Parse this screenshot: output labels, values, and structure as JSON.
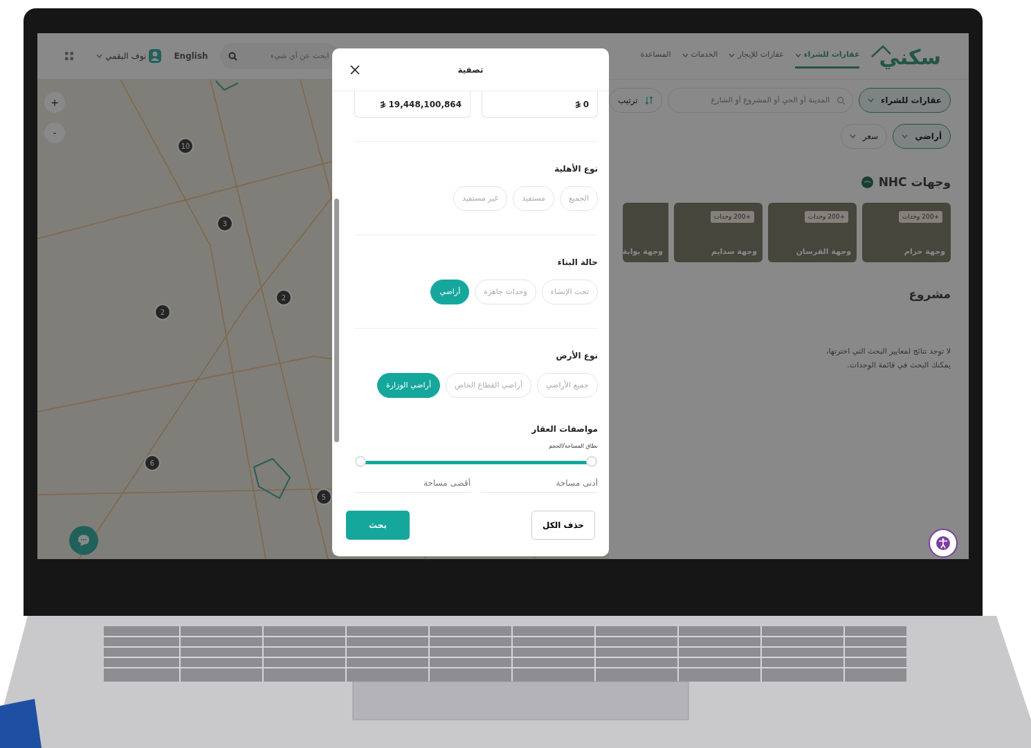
{
  "header": {
    "logo": "سكني",
    "nav": [
      {
        "label": "عقارات للشراء",
        "selected": true,
        "dropdown": true
      },
      {
        "label": "عقارات للإيجار",
        "selected": false,
        "dropdown": true
      },
      {
        "label": "الخدمات",
        "selected": false,
        "dropdown": true
      },
      {
        "label": "المساعدة",
        "selected": false,
        "dropdown": false
      }
    ],
    "search_placeholder": "ابحث عن أي شيء",
    "language": "English",
    "user": "نوف البقمي"
  },
  "map": {
    "zoom_in": "+",
    "zoom_out": "-",
    "markers": [
      {
        "label": "10"
      },
      {
        "label": "3"
      },
      {
        "label": "2"
      },
      {
        "label": "2"
      },
      {
        "label": "6"
      },
      {
        "label": "5"
      }
    ]
  },
  "results": {
    "search_placeholder": "المدينة أو الحي أو المشروع أو الشارع",
    "sort": "ترتيب",
    "filters": [
      {
        "label": "عقارات للشراء",
        "selected": true
      },
      {
        "label": "أراضي",
        "selected": true
      },
      {
        "label": "سعر",
        "selected": false
      }
    ],
    "destinations_title": "وجهات NHC",
    "destinations": [
      {
        "name": "وجهة خزام",
        "badge": "+200 وحدات"
      },
      {
        "name": "وجهة الفرسان",
        "badge": "+200 وحدات"
      },
      {
        "name": "وجهة سدايم",
        "badge": "+200 وحدات"
      },
      {
        "name": "وجهة بوابة"
      }
    ],
    "project_title": "مشروع",
    "empty_message": "لا توجد نتائج لمعايير البحث التي اخترتها، يمكنك البحث في قائمة الوحدات."
  },
  "filter_dialog": {
    "title": "تصفية",
    "price_min": "0",
    "price_max": "19,448,100,864",
    "groups": [
      {
        "title": "نوع الأهلية",
        "options": [
          {
            "label": "الجميع",
            "selected": false
          },
          {
            "label": "مستفيد",
            "selected": false
          },
          {
            "label": "غير مستفيد",
            "selected": false
          }
        ]
      },
      {
        "title": "حالة البناء",
        "options": [
          {
            "label": "تحت الإنشاء",
            "selected": false
          },
          {
            "label": "وحدات جاهزة",
            "selected": false
          },
          {
            "label": "أراضي",
            "selected": true
          }
        ]
      },
      {
        "title": "نوع الأرض",
        "options": [
          {
            "label": "جميع الأراضي",
            "selected": false
          },
          {
            "label": "أراضي القطاع الخاص",
            "selected": false
          },
          {
            "label": "أراضي الوزارة",
            "selected": true
          }
        ]
      }
    ],
    "specs_title": "مواصفات العقار",
    "range_label": "نطاق المساحة/الحجم",
    "range": {
      "low": {
        "level": 0
      },
      "high": {
        "level": 1
      }
    },
    "min_area_placeholder": "أدنى مساحة",
    "max_area_placeholder": "أقصى مساحة",
    "clear_button": "حذف الكل",
    "search_button": "بحث"
  }
}
